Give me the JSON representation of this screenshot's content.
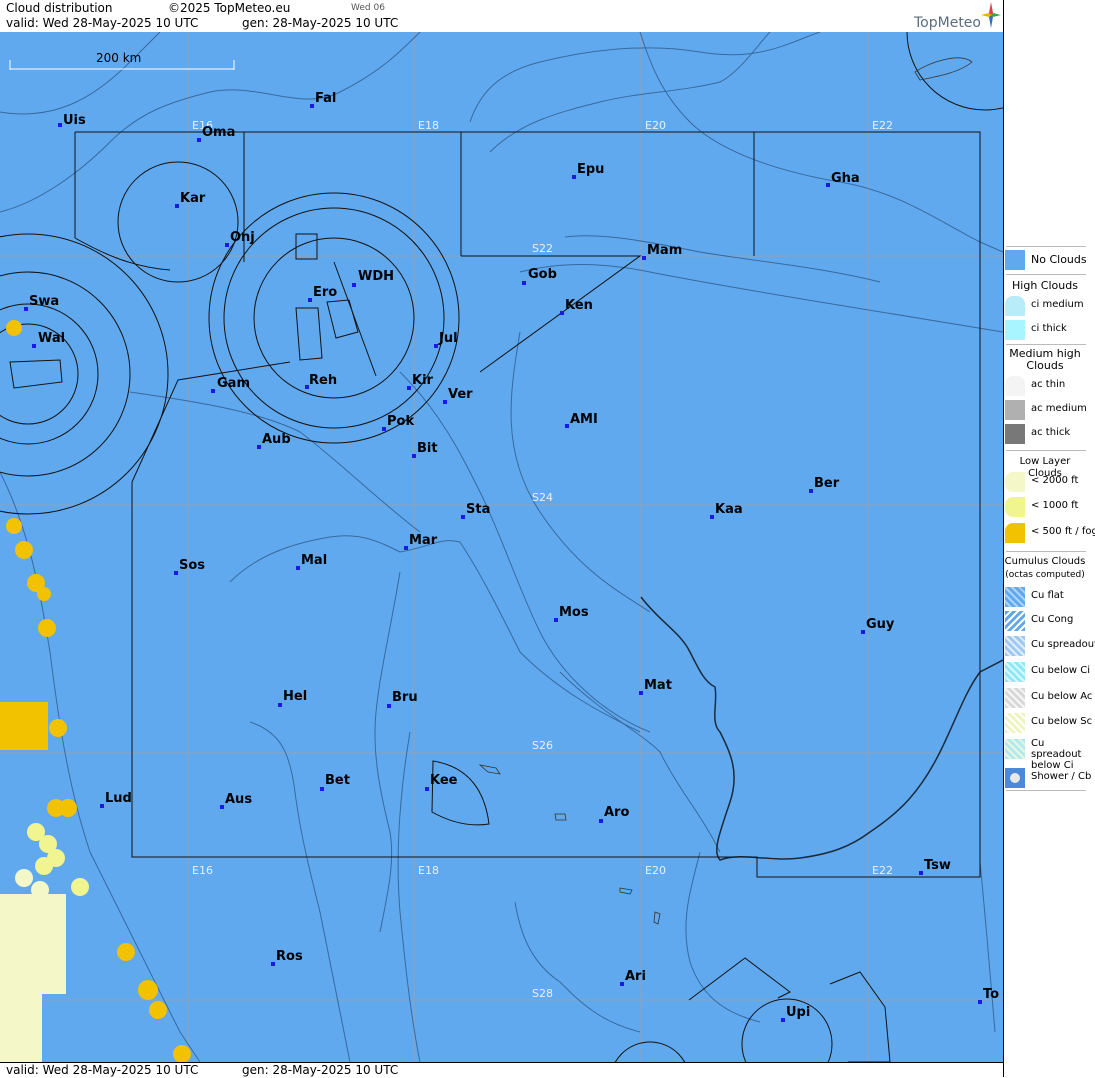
{
  "header": {
    "title": "Cloud distribution",
    "copyright": "©2025 TopMeteo.eu",
    "day_code": "Wed 06",
    "valid": "valid:  Wed  28-May-2025  10 UTC",
    "gen": "gen: 28-May-2025 10 UTC",
    "logo": "TopMeteo"
  },
  "footer": {
    "valid": "valid:  Wed  28-May-2025  10 UTC",
    "gen": "gen: 28-May-2025 10 UTC"
  },
  "map": {
    "scale_label": "200 km",
    "colors": {
      "background": "#61a9ef",
      "low_cloud_yellow": "#f2c200",
      "low_cloud_pale": "#f4f8c8",
      "low_cloud_light": "#f0f590"
    },
    "grid_labels": {
      "lon_top": [
        "E16",
        "E18",
        "E20",
        "E22"
      ],
      "lon_bottom": [
        "E16",
        "E18",
        "E20",
        "E22"
      ],
      "lat": [
        "S22",
        "S24",
        "S26",
        "S28"
      ]
    },
    "cities": [
      {
        "name": "Uis"
      },
      {
        "name": "Fal"
      },
      {
        "name": "Oma"
      },
      {
        "name": "Kar"
      },
      {
        "name": "Epu"
      },
      {
        "name": "Gha"
      },
      {
        "name": "Onj"
      },
      {
        "name": "Mam"
      },
      {
        "name": "WDH"
      },
      {
        "name": "Gob"
      },
      {
        "name": "Swa"
      },
      {
        "name": "Ero"
      },
      {
        "name": "Ken"
      },
      {
        "name": "Wal"
      },
      {
        "name": "Jul"
      },
      {
        "name": "Gam"
      },
      {
        "name": "Reh"
      },
      {
        "name": "Kir"
      },
      {
        "name": "Ver"
      },
      {
        "name": "AMI"
      },
      {
        "name": "Pok"
      },
      {
        "name": "Aub"
      },
      {
        "name": "Bit"
      },
      {
        "name": "Ber"
      },
      {
        "name": "Sta"
      },
      {
        "name": "Kaa"
      },
      {
        "name": "Mar"
      },
      {
        "name": "Sos"
      },
      {
        "name": "Mal"
      },
      {
        "name": "Mos"
      },
      {
        "name": "Guy"
      },
      {
        "name": "Mat"
      },
      {
        "name": "Hel"
      },
      {
        "name": "Bru"
      },
      {
        "name": "Bet"
      },
      {
        "name": "Kee"
      },
      {
        "name": "Lud"
      },
      {
        "name": "Aus"
      },
      {
        "name": "Aro"
      },
      {
        "name": "Tsw"
      },
      {
        "name": "Ros"
      },
      {
        "name": "Ari"
      },
      {
        "name": "Upi"
      },
      {
        "name": "To"
      }
    ]
  },
  "legend": {
    "no_clouds": "No Clouds",
    "high_title": "High Clouds",
    "high_items": [
      "ci medium",
      "ci thick"
    ],
    "medium_title": "Medium high Clouds",
    "medium_items": [
      "ac thin",
      "ac medium",
      "ac thick"
    ],
    "low_title": "Low Layer Clouds",
    "low_items": [
      "< 2000 ft",
      "< 1000 ft",
      "< 500 ft / fog"
    ],
    "cumulus_title": "Cumulus Clouds",
    "cumulus_sub": "(octas computed)",
    "cumulus_items": [
      "Cu flat",
      "Cu Cong",
      "Cu spreadout",
      "Cu below Ci",
      "Cu below Ac",
      "Cu below Sc",
      "Cu spreadout below Ci",
      "Shower / Cb"
    ]
  }
}
